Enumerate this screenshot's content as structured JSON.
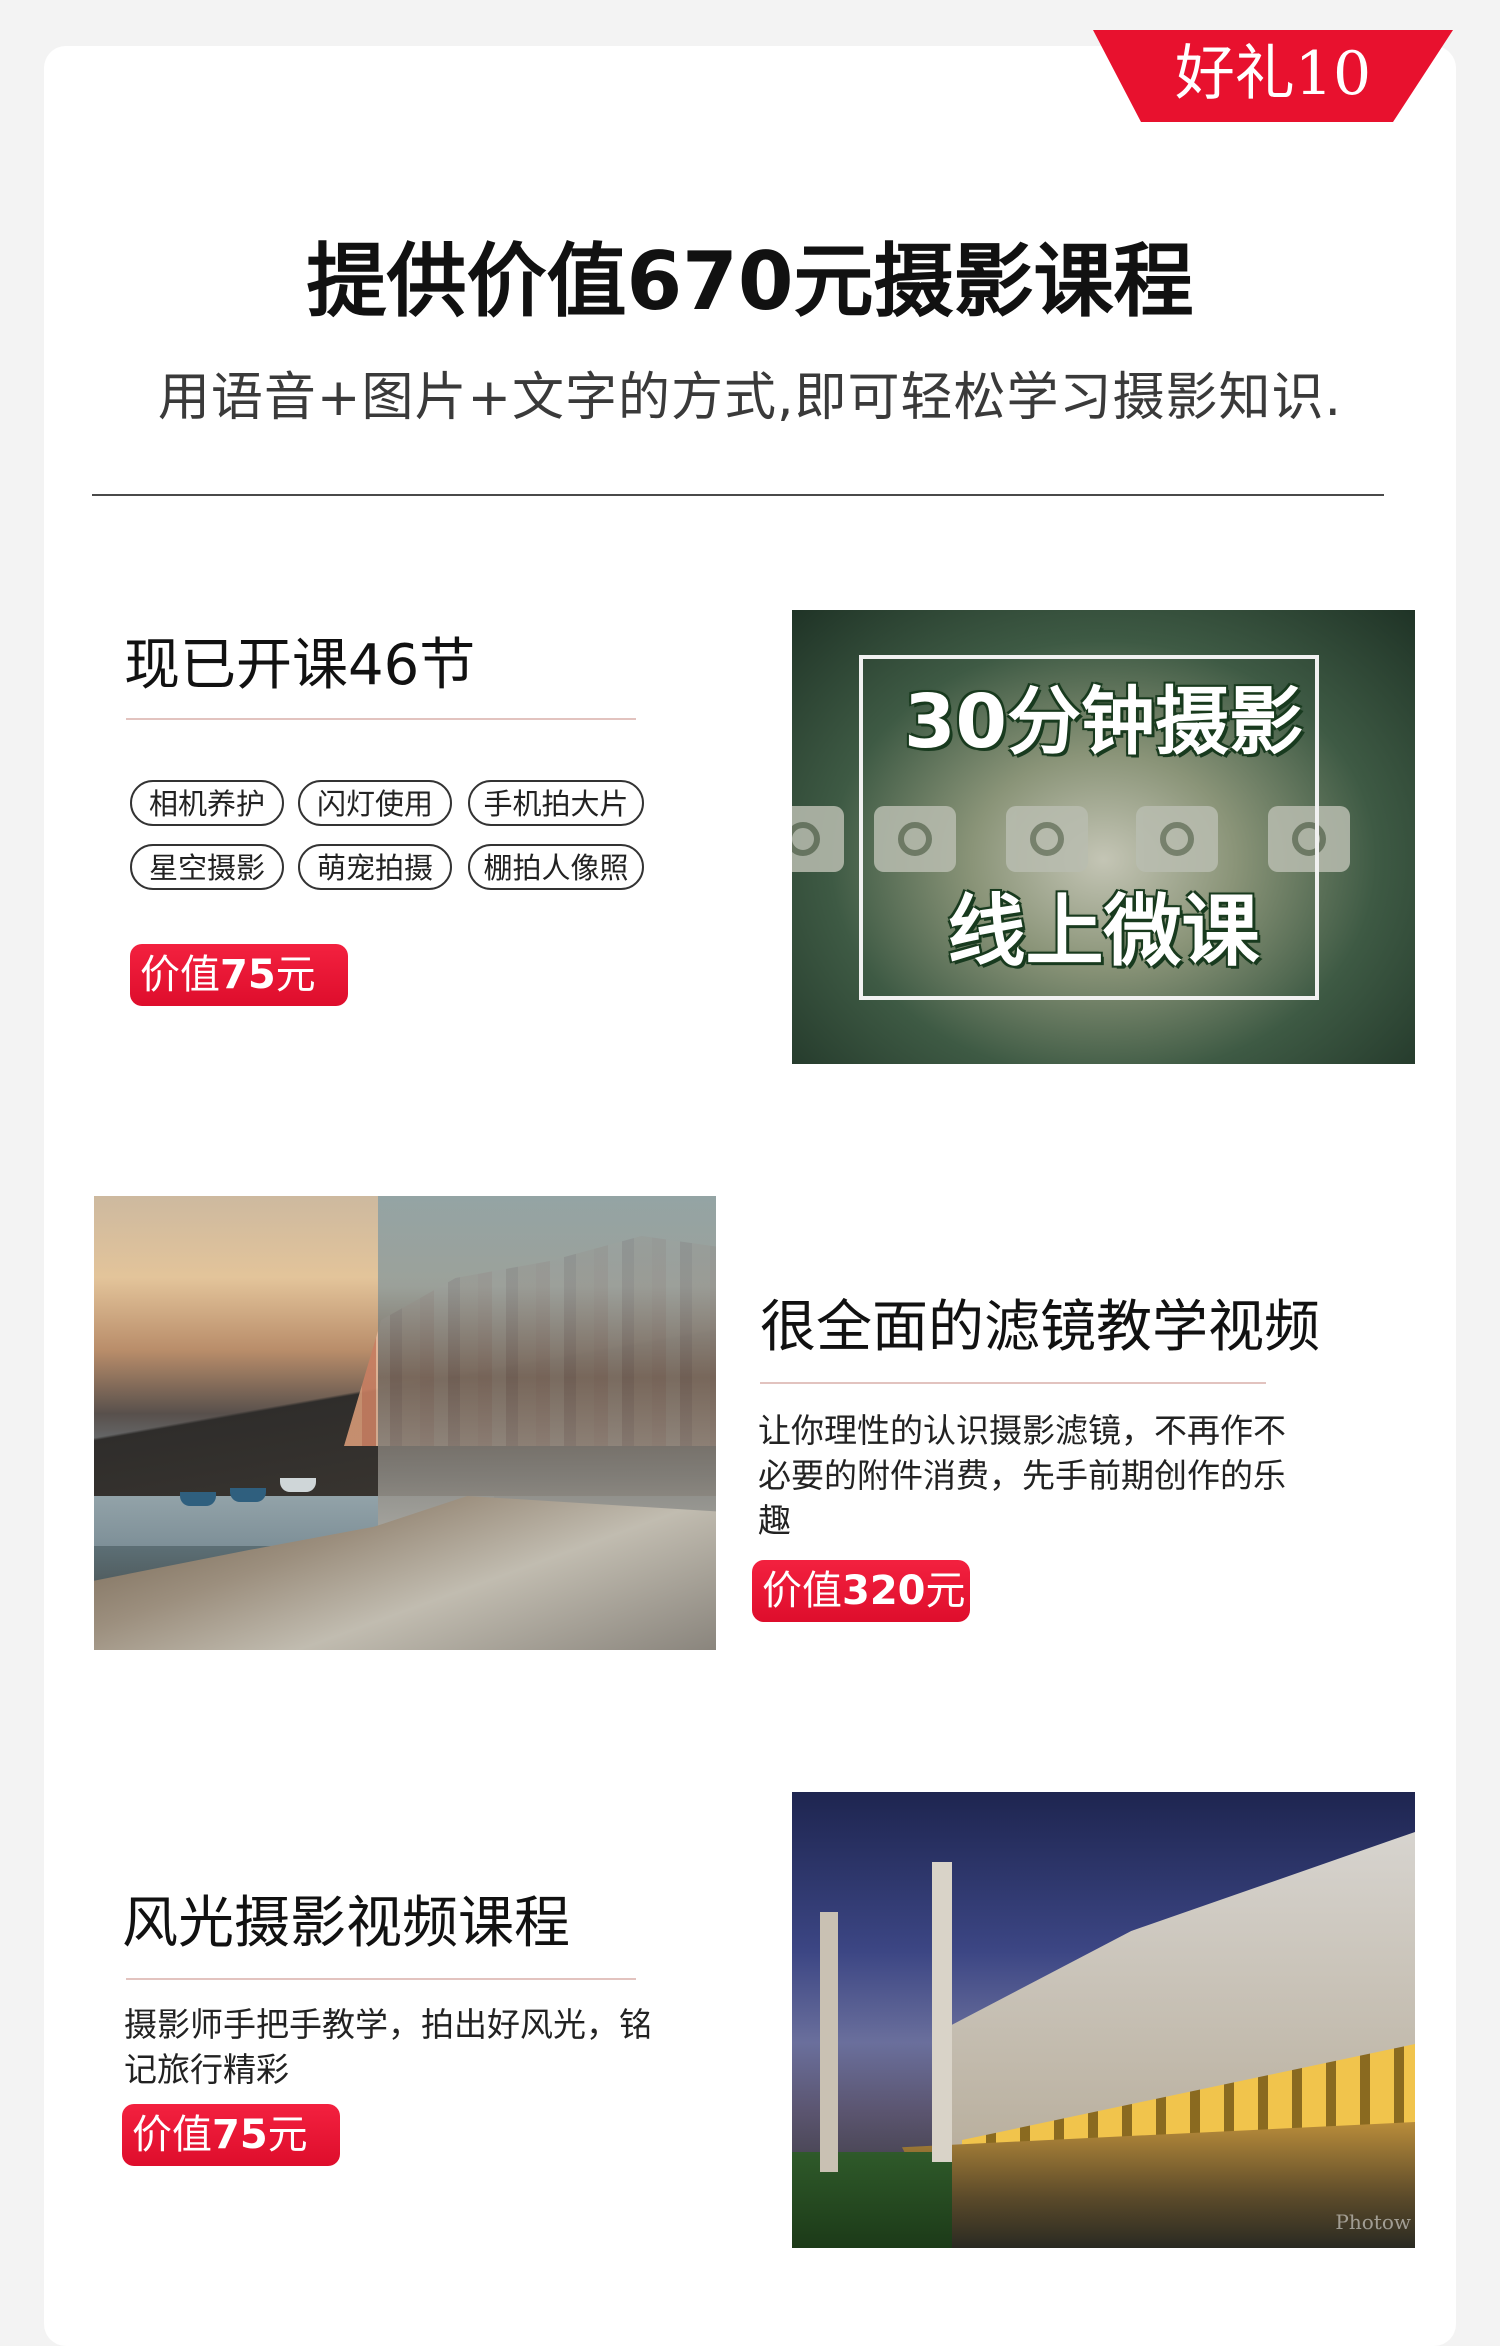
{
  "badge": {
    "label": "好礼10",
    "color": "#e8112e"
  },
  "header": {
    "title": "提供价值670元摄影课程",
    "subtitle": "用语音+图片+文字的方式,即可轻松学习摄影知识."
  },
  "sections": [
    {
      "title": "现已开课46节",
      "tags": [
        "相机养护",
        "闪灯使用",
        "手机拍大片",
        "星空摄影",
        "萌宠拍摄",
        "棚拍人像照"
      ],
      "price": {
        "prefix": "价值",
        "amount": "75",
        "suffix": "元"
      },
      "image": {
        "line1": "30分钟摄影",
        "line2": "线上微课",
        "icon": "camera-icon"
      }
    },
    {
      "title": "很全面的滤镜教学视频",
      "description": "让你理性的认识摄影滤镜，不再作不必要的附件消费，先手前期创作的乐趣",
      "price": {
        "prefix": "价值",
        "amount": "320",
        "suffix": "元"
      }
    },
    {
      "title": "风光摄影视频课程",
      "description": "摄影师手把手教学，拍出好风光，铭记旅行精彩",
      "price": {
        "prefix": "价值",
        "amount": "75",
        "suffix": "元"
      },
      "image": {
        "watermark": "Photow"
      }
    }
  ],
  "colors": {
    "price_red": "#e8112e",
    "text": "#1e1e1e",
    "divider": "#e2c3bf"
  }
}
